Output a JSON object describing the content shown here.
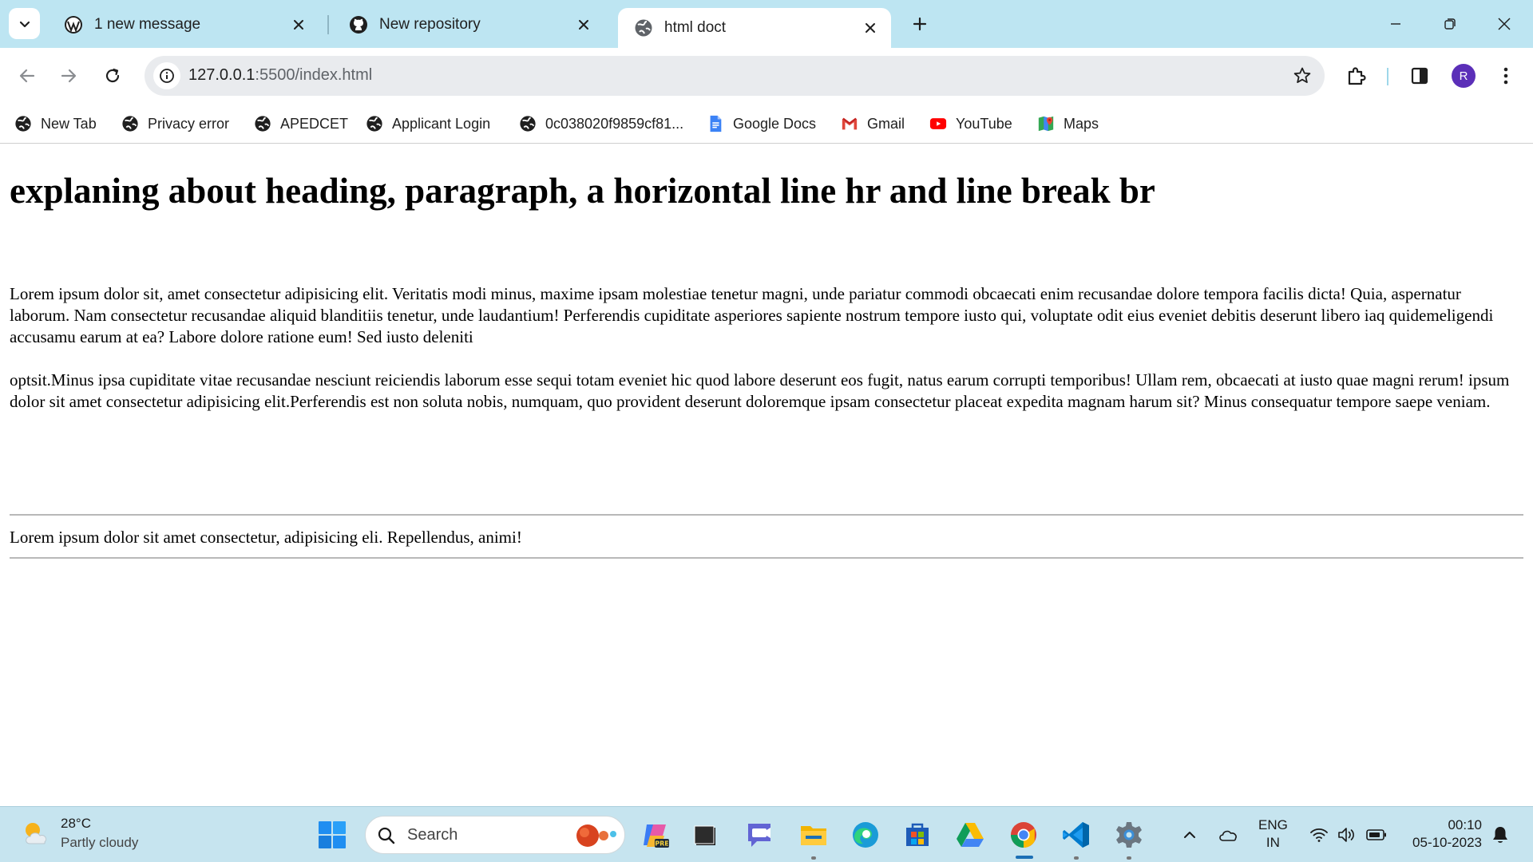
{
  "browser": {
    "tabs": [
      {
        "title": "1 new message",
        "icon": "wordpress-icon",
        "active": false
      },
      {
        "title": "New repository",
        "icon": "github-icon",
        "active": false
      },
      {
        "title": "html doct",
        "icon": "globe-icon",
        "active": true
      }
    ],
    "address": {
      "host": "127.0.0.1",
      "path": ":5500/index.html"
    },
    "profile_initial": "R"
  },
  "bookmarks": [
    {
      "label": "New Tab",
      "icon": "globe-icon"
    },
    {
      "label": "Privacy error",
      "icon": "globe-icon"
    },
    {
      "label": "APEDCET",
      "icon": "globe-icon"
    },
    {
      "label": "Applicant Login",
      "icon": "globe-icon"
    },
    {
      "label": "0c038020f9859cf81...",
      "icon": "globe-icon"
    },
    {
      "label": "Google Docs",
      "icon": "google-docs-icon"
    },
    {
      "label": "Gmail",
      "icon": "gmail-icon"
    },
    {
      "label": "YouTube",
      "icon": "youtube-icon"
    },
    {
      "label": "Maps",
      "icon": "maps-icon"
    }
  ],
  "page": {
    "heading": "explaning about heading, paragraph, a horizontal line hr and line break br",
    "paragraph_1": "Lorem ipsum dolor sit, amet consectetur adipisicing elit. Veritatis modi minus, maxime ipsam molestiae tenetur magni, unde pariatur commodi obcaecati enim recusandae dolore tempora facilis dicta! Quia, aspernatur laborum. Nam consectetur recusandae aliquid blanditiis tenetur, unde laudantium! Perferendis cupiditate asperiores sapiente nostrum tempore iusto qui, voluptate odit eius eveniet debitis deserunt libero iaq quidemeligendi accusamu earum at ea? Labore dolore ratione eum! Sed iusto deleniti",
    "paragraph_2": "optsit.Minus ipsa cupiditate vitae recusandae nesciunt reiciendis laborum esse sequi totam eveniet hic quod labore deserunt eos fugit, natus earum corrupti temporibus! Ullam rem, obcaecati at iusto quae magni rerum! ipsum dolor sit amet consectetur adipisicing elit.Perferendis est non soluta nobis, numquam, quo provident deserunt doloremque ipsam consectetur placeat expedita magnam harum sit? Minus consequatur tempore saepe veniam.",
    "paragraph_3": "Lorem ipsum dolor sit amet consectetur, adipisicing eli. Repellendus, animi!"
  },
  "taskbar": {
    "weather": {
      "temp": "28°C",
      "desc": "Partly cloudy"
    },
    "search_placeholder": "Search",
    "language": {
      "line1": "ENG",
      "line2": "IN"
    },
    "clock": {
      "time": "00:10",
      "date": "05-10-2023"
    }
  },
  "colors": {
    "tabstrip_bg": "#bde5f2",
    "taskbar_bg": "#c6e4ef",
    "avatar_bg": "#5b2fb8",
    "omnibox_bg": "#e9ebee"
  }
}
